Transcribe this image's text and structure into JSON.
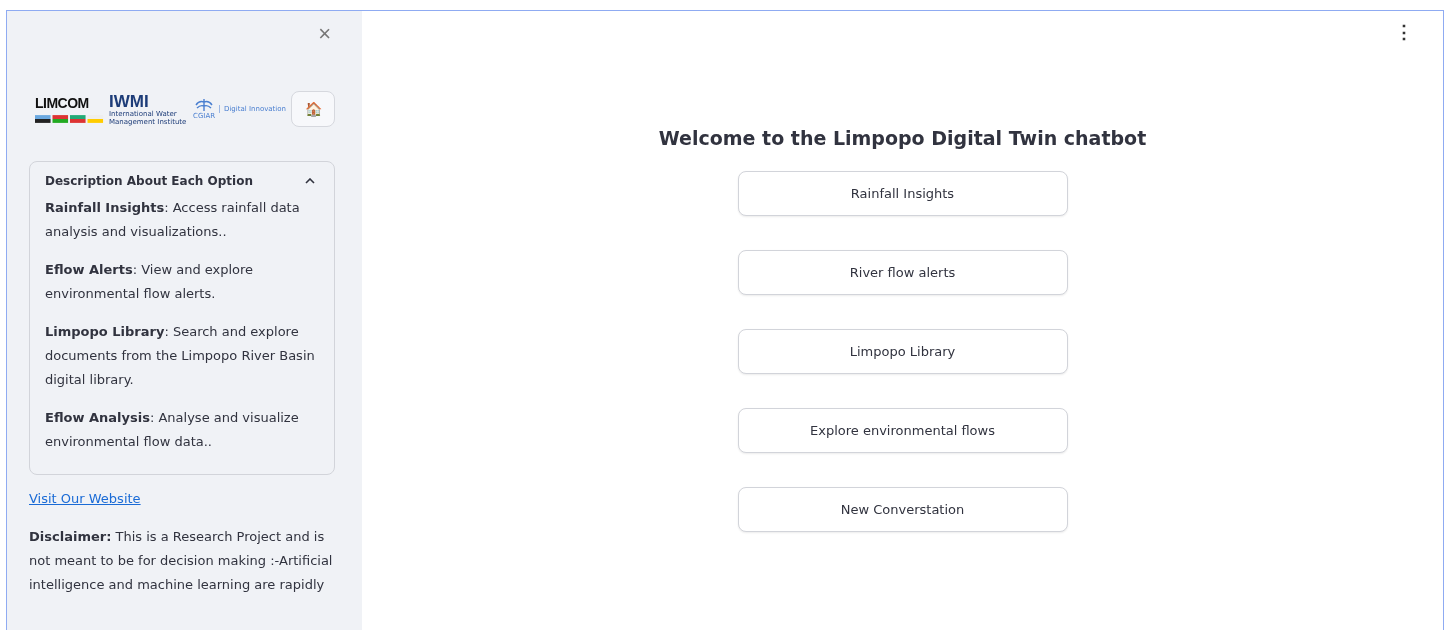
{
  "sidebar": {
    "close_icon": "×",
    "logos": {
      "limcom": "LIMCOM",
      "iwmi": "IWMI",
      "iwmi_caption": "International Water Management Institute",
      "cgiar": "CGIAR",
      "initiative": "Digital Innovation"
    },
    "home_button": {
      "label": "🏠"
    },
    "expander": {
      "title": "Description About Each Option",
      "expanded": true,
      "items": [
        {
          "text": "**Rainfall Insights**: Access rainfall data analysis and visualizations.."
        },
        {
          "text": "**Eflow Alerts**: View and explore environmental flow alerts."
        },
        {
          "text": "**Limpopo Library**: Search and explore documents from the Limpopo River Basin digital library."
        },
        {
          "text": "**Eflow Analysis**: Analyse and visualize environmental flow data.."
        }
      ]
    },
    "link": "Visit Our Website",
    "disclaimer": "**Disclaimer:** This is a Research Project and is not meant to be for decision making :-Artificial intelligence and machine learning are rapidly"
  },
  "main": {
    "menu_icon": "⋮",
    "title": "Welcome to the Limpopo Digital Twin chatbot",
    "buttons": [
      "Rainfall Insights",
      "River flow alerts",
      "Limpopo Library",
      "Explore environmental flows",
      "New Converstation"
    ]
  }
}
